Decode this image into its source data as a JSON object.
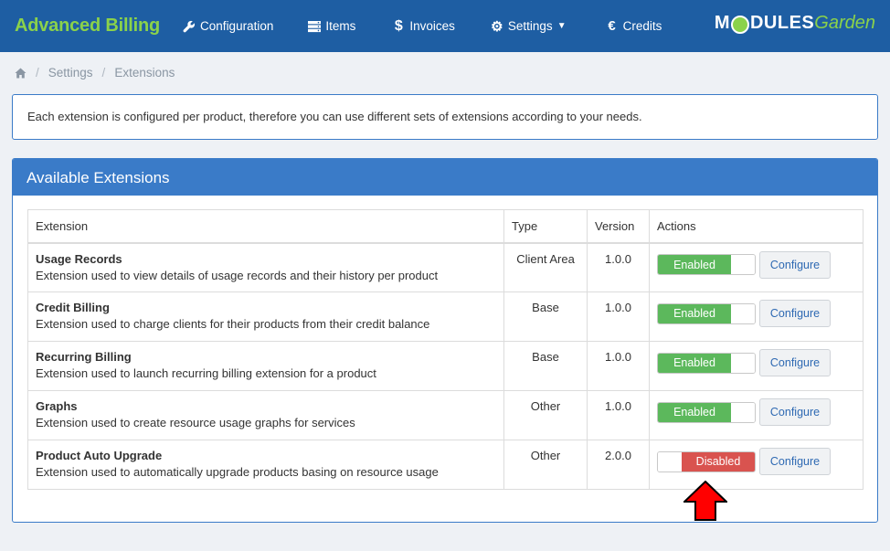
{
  "navbar": {
    "brand": "Advanced Billing",
    "items": [
      {
        "label": "Configuration",
        "icon": "wrench-icon"
      },
      {
        "label": "Items",
        "icon": "server-icon"
      },
      {
        "label": "Invoices",
        "icon": "dollar-icon"
      },
      {
        "label": "Settings",
        "icon": "gear-icon"
      },
      {
        "label": "Credits",
        "icon": "euro-icon"
      }
    ],
    "logo_modules": "M",
    "logo_modules_rest": "DULES",
    "logo_garden": "Garden"
  },
  "breadcrumb": {
    "items": [
      "Settings",
      "Extensions"
    ]
  },
  "info": {
    "text": "Each extension is configured per product, therefore you can use different sets of extensions according to your needs."
  },
  "panel": {
    "title": "Available Extensions",
    "columns": [
      "Extension",
      "Type",
      "Version",
      "Actions"
    ],
    "rows": [
      {
        "name": "Usage Records",
        "description": "Extension used to view details of usage records and their history per product",
        "type": "Client Area",
        "version": "1.0.0",
        "status": "Enabled",
        "configure": "Configure"
      },
      {
        "name": "Credit Billing",
        "description": "Extension used to charge clients for their products from their credit balance",
        "type": "Base",
        "version": "1.0.0",
        "status": "Enabled",
        "configure": "Configure"
      },
      {
        "name": "Recurring Billing",
        "description": "Extension used to launch recurring billing extension for a product",
        "type": "Base",
        "version": "1.0.0",
        "status": "Enabled",
        "configure": "Configure"
      },
      {
        "name": "Graphs",
        "description": "Extension used to create resource usage graphs for services",
        "type": "Other",
        "version": "1.0.0",
        "status": "Enabled",
        "configure": "Configure"
      },
      {
        "name": "Product Auto Upgrade",
        "description": "Extension used to automatically upgrade products basing on resource usage",
        "type": "Other",
        "version": "2.0.0",
        "status": "Disabled",
        "configure": "Configure"
      }
    ]
  },
  "colors": {
    "navbar": "#1e5ea3",
    "brand": "#8bd24a",
    "panel_heading": "#3a7bc8",
    "enabled": "#5cb85c",
    "disabled": "#d9534f",
    "arrow": "#ff0000"
  }
}
